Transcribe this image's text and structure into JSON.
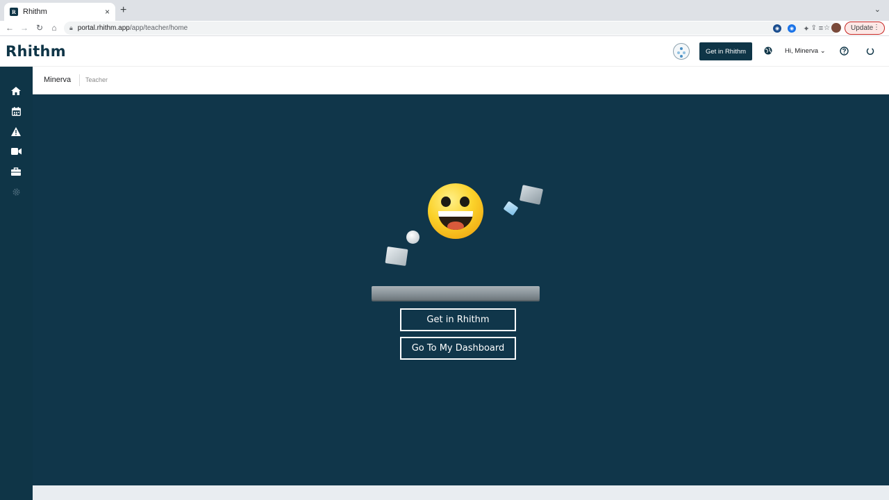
{
  "browser": {
    "tab_title": "Rhithm",
    "tab_favicon_letter": "R",
    "tab_close": "×",
    "new_tab": "+",
    "tab_menu": "⌄",
    "url_host": "portal.rhithm.app",
    "url_path": "/app/teacher/home",
    "update_label": "Update",
    "update_dots": "⋮"
  },
  "header": {
    "logo": "Rhithm",
    "get_in_label": "Get in Rhithm",
    "greeting": "Hi, Minerva",
    "greeting_chevron": "⌄"
  },
  "subheader": {
    "name": "Minerva",
    "role": "Teacher"
  },
  "sidebar": {
    "items": [
      {
        "icon": "home-icon"
      },
      {
        "icon": "calendar-icon"
      },
      {
        "icon": "alert-icon"
      },
      {
        "icon": "video-icon"
      },
      {
        "icon": "toolbox-icon"
      },
      {
        "icon": "settings-icon"
      }
    ]
  },
  "main": {
    "primary_button": "Get in Rhithm",
    "secondary_button": "Go To My Dashboard"
  },
  "colors": {
    "brand_dark": "#0f3547",
    "main_bg": "#10364a",
    "emoji_yellow": "#fbd22a"
  }
}
